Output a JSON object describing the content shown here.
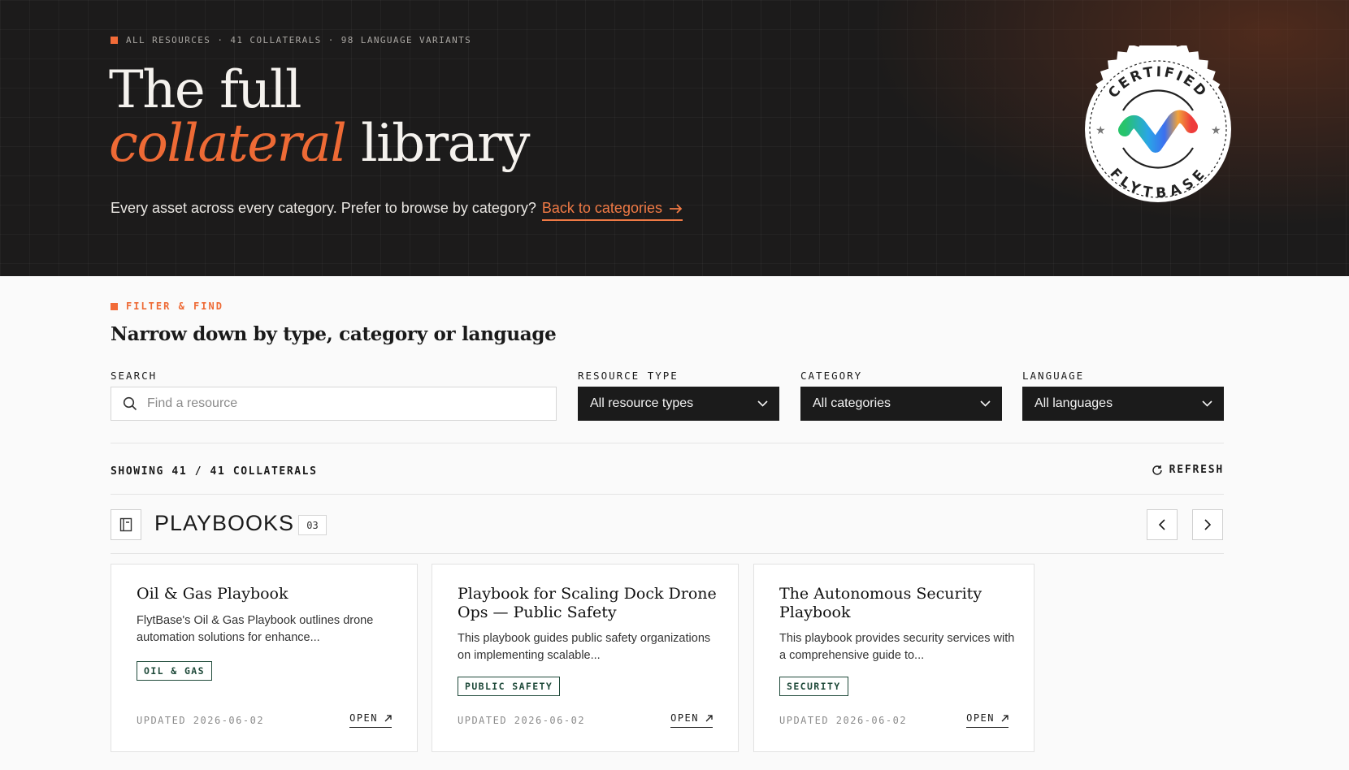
{
  "hero": {
    "eyebrow": "ALL RESOURCES · 41 COLLATERALS · 98 LANGUAGE VARIANTS",
    "title_line1": "The full",
    "title_accent": "collateral",
    "title_rest": " library",
    "subtitle": "Every asset across every category. Prefer to browse by category?",
    "back_link": "Back to categories",
    "badge_top": "CERTIFIED",
    "badge_bottom": "FLYTBASE"
  },
  "filter": {
    "eyebrow": "FILTER & FIND",
    "title": "Narrow down by type, category or language",
    "search_label": "SEARCH",
    "search_placeholder": "Find a resource",
    "search_value": "",
    "type_label": "RESOURCE TYPE",
    "type_value": "All resource types",
    "category_label": "CATEGORY",
    "category_value": "All categories",
    "language_label": "LANGUAGE",
    "language_value": "All languages"
  },
  "results": {
    "showing": "SHOWING 41 / 41 COLLATERALS",
    "refresh": "REFRESH"
  },
  "section": {
    "title": "PLAYBOOKS",
    "count": "03"
  },
  "cards": [
    {
      "title": "Oil & Gas Playbook",
      "description": "FlytBase's Oil & Gas Playbook outlines drone automation solutions for enhance...",
      "tag": "OIL & GAS",
      "updated": "UPDATED 2026-06-02",
      "open": "OPEN"
    },
    {
      "title": "Playbook for Scaling Dock Drone Ops — Public Safety",
      "description": "This playbook guides public safety organizations on implementing scalable...",
      "tag": "PUBLIC SAFETY",
      "updated": "UPDATED 2026-06-02",
      "open": "OPEN"
    },
    {
      "title": "The Autonomous Security Playbook",
      "description": "This playbook provides security services with a comprehensive guide to...",
      "tag": "SECURITY",
      "updated": "UPDATED 2026-06-02",
      "open": "OPEN"
    }
  ],
  "colors": {
    "accent": "#ee6a35",
    "hero_bg": "#1c1b1b",
    "select_bg": "#1b1b1b",
    "tag": "#1f4a3a"
  },
  "icons": [
    "search-icon",
    "chevron-down-icon",
    "refresh-icon",
    "book-icon",
    "chevron-left-icon",
    "chevron-right-icon",
    "arrow-right-icon",
    "arrow-up-right-icon"
  ]
}
